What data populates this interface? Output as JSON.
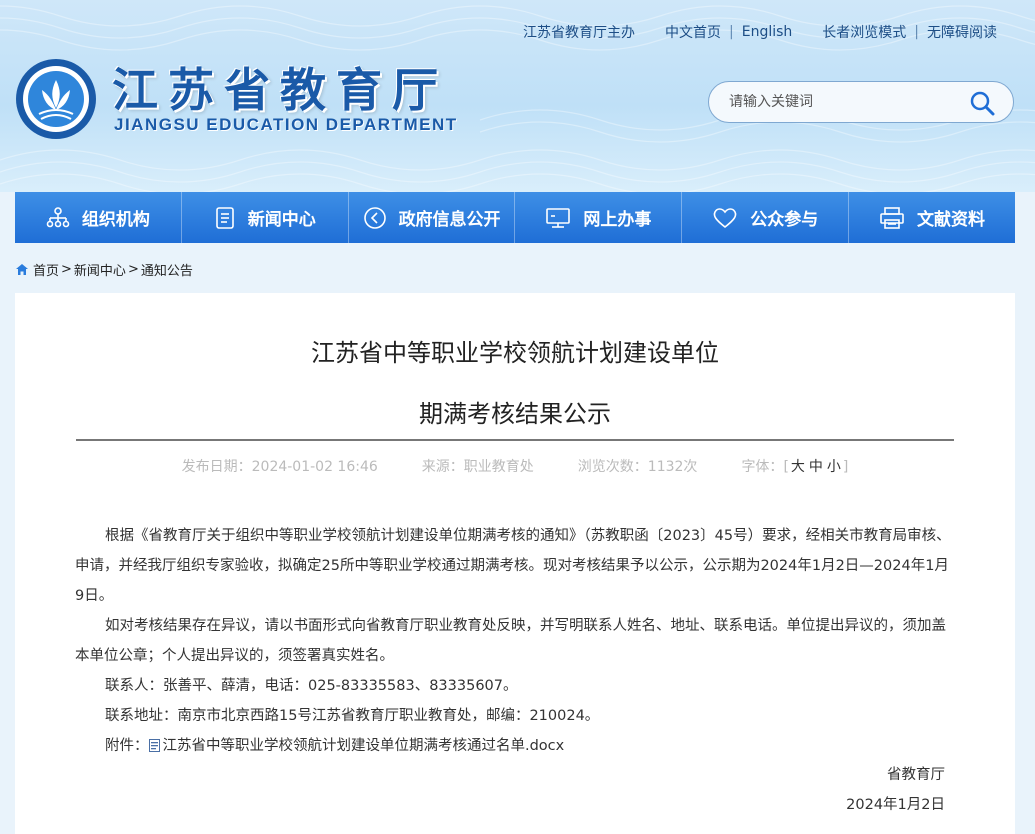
{
  "header": {
    "top_links": [
      "江苏省教育厅主办",
      "中文首页",
      "English",
      "长者浏览模式",
      "无障碍阅读"
    ],
    "title_cn": "江苏省教育厅",
    "title_en": "JIANGSU EDUCATION DEPARTMENT",
    "search_placeholder": "请输入关键词",
    "colors": {
      "brand_blue": "#1a5aa8",
      "nav_blue": "#2a7cdd"
    }
  },
  "nav": {
    "items": [
      {
        "label": "组织机构",
        "icon": "org-chart-icon"
      },
      {
        "label": "新闻中心",
        "icon": "document-icon"
      },
      {
        "label": "政府信息公开",
        "icon": "arrow-circle-icon"
      },
      {
        "label": "网上办事",
        "icon": "monitor-icon"
      },
      {
        "label": "公众参与",
        "icon": "heart-icon"
      },
      {
        "label": "文献资料",
        "icon": "printer-icon"
      }
    ]
  },
  "breadcrumb": {
    "home": "首页",
    "sep": ">",
    "items": [
      "新闻中心",
      "通知公告"
    ]
  },
  "article": {
    "title_line1": "江苏省中等职业学校领航计划建设单位",
    "title_line2": "期满考核结果公示",
    "meta": {
      "date_label": "发布日期：",
      "date": "2024-01-02 16:46",
      "source_label": "来源：",
      "source": "职业教育处",
      "views_label": "浏览次数：",
      "views": "1132次",
      "font_label": "字体：",
      "font_open": "[",
      "font_sizes": [
        "大",
        "中",
        "小"
      ],
      "font_close": "]"
    },
    "paragraph1": "根据《省教育厅关于组织中等职业学校领航计划建设单位期满考核的通知》（苏教职函〔2023〕45号）要求，经相关市教育局审核、申请，并经我厅组织专家验收，拟确定25所中等职业学校通过期满考核。现对考核结果予以公示，公示期为2024年1月2日—2024年1月9日。",
    "paragraph2": "如对考核结果存在异议，请以书面形式向省教育厅职业教育处反映，并写明联系人姓名、地址、联系电话。单位提出异议的，须加盖本单位公章；个人提出异议的，须签署真实姓名。",
    "contact": "联系人：张善平、薛清，电话：025-83335583、83335607。",
    "address": "联系地址：南京市北京西路15号江苏省教育厅职业教育处，邮编：210024。",
    "attachment_label": "附件：",
    "attachment_file": "江苏省中等职业学校领航计划建设单位期满考核通过名单.docx",
    "signature": "省教育厅",
    "sign_date": "2024年1月2日"
  }
}
